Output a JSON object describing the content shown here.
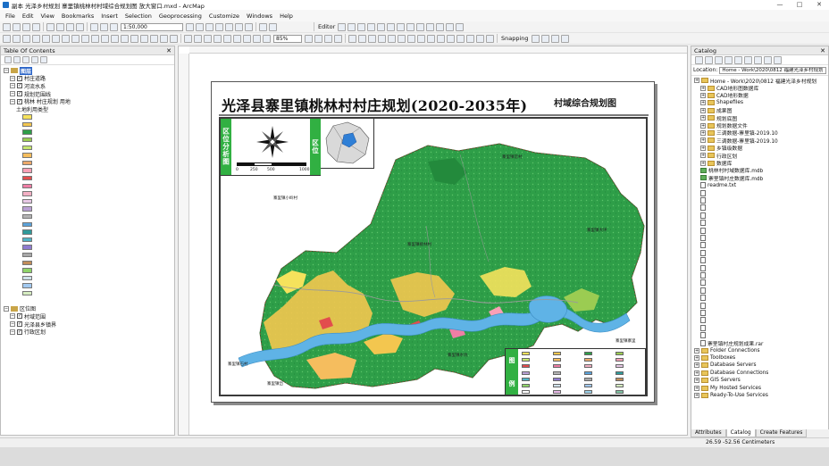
{
  "window": {
    "title": "副本 光泽乡村规划 寨里镇桃林村村域综合规划图 放大窗口.mxd - ArcMap"
  },
  "menu": [
    "File",
    "Edit",
    "View",
    "Bookmarks",
    "Insert",
    "Selection",
    "Geoprocessing",
    "Customize",
    "Windows",
    "Help"
  ],
  "toolbar": {
    "scale": "1:50,000",
    "zoom": "85%",
    "editor_label": "Editor",
    "snapping_label": "Snapping"
  },
  "toc": {
    "title": "Table Of Contents",
    "items": [
      {
        "label": "图层",
        "level": 0,
        "kind": "frame",
        "selected": true
      },
      {
        "label": "村庄道路",
        "level": 1,
        "kind": "layer"
      },
      {
        "label": "河流水系",
        "level": 1,
        "kind": "layer"
      },
      {
        "label": "规划范围线",
        "level": 1,
        "kind": "layer"
      },
      {
        "label": "桃林 村庄规划 用地",
        "level": 1,
        "kind": "layer"
      },
      {
        "label": "土地利用类型",
        "level": 2,
        "kind": "caption"
      },
      {
        "label": "",
        "level": 3,
        "kind": "legend",
        "color": "#f5e25c"
      },
      {
        "label": "",
        "level": 3,
        "kind": "legend",
        "color": "#f3c64f"
      },
      {
        "label": "",
        "level": 3,
        "kind": "legend",
        "color": "#2e9e48"
      },
      {
        "label": "",
        "level": 3,
        "kind": "legend",
        "color": "#9bcc52"
      },
      {
        "label": "",
        "level": 3,
        "kind": "legend",
        "color": "#c5e66e"
      },
      {
        "label": "",
        "level": 3,
        "kind": "legend",
        "color": "#f5bd5e"
      },
      {
        "label": "",
        "level": 3,
        "kind": "legend",
        "color": "#eca96a"
      },
      {
        "label": "",
        "level": 3,
        "kind": "legend",
        "color": "#f9a0b6"
      },
      {
        "label": "",
        "level": 3,
        "kind": "legend",
        "color": "#e24d4d"
      },
      {
        "label": "",
        "level": 3,
        "kind": "legend",
        "color": "#ef7ea5"
      },
      {
        "label": "",
        "level": 3,
        "kind": "legend",
        "color": "#f3b0c4"
      },
      {
        "label": "",
        "level": 3,
        "kind": "legend",
        "color": "#e7c8e5"
      },
      {
        "label": "",
        "level": 3,
        "kind": "legend",
        "color": "#b9a0d4"
      },
      {
        "label": "",
        "level": 3,
        "kind": "legend",
        "color": "#b3b3b3"
      },
      {
        "label": "",
        "level": 3,
        "kind": "legend",
        "color": "#5ba3db"
      },
      {
        "label": "",
        "level": 3,
        "kind": "legend",
        "color": "#2f9a9a"
      },
      {
        "label": "",
        "level": 3,
        "kind": "legend",
        "color": "#52b4c6"
      },
      {
        "label": "",
        "level": 3,
        "kind": "legend",
        "color": "#8f7bd0"
      },
      {
        "label": "",
        "level": 3,
        "kind": "legend",
        "color": "#a9a9a9"
      },
      {
        "label": "",
        "level": 3,
        "kind": "legend",
        "color": "#c18d5a"
      },
      {
        "label": "",
        "level": 3,
        "kind": "legend",
        "color": "#8fd46a"
      },
      {
        "label": "",
        "level": 3,
        "kind": "legend",
        "color": "#cfe1ea"
      },
      {
        "label": "",
        "level": 3,
        "kind": "legend",
        "color": "#a2c9f0"
      },
      {
        "label": "",
        "level": 3,
        "kind": "legend",
        "color": "#d5ecc0"
      },
      {
        "label": "",
        "level": 0,
        "kind": "spacer"
      },
      {
        "label": "区位图",
        "level": 0,
        "kind": "frame",
        "selected": false
      },
      {
        "label": "村域范围",
        "level": 1,
        "kind": "layer"
      },
      {
        "label": "光泽县乡镇界",
        "level": 1,
        "kind": "layer"
      },
      {
        "label": "行政区划",
        "level": 1,
        "kind": "layer"
      }
    ]
  },
  "map": {
    "title": "光泽县寨里镇桃林村村庄规划(2020-2035年)",
    "subtitle": "村域综合规划图",
    "inset_label_1": "区位分析图",
    "inset_label_2": "区位",
    "scalebar_ticks": [
      "0",
      "250",
      "500",
      "1000"
    ],
    "places": [
      {
        "text": "寨里镇小岭村"
      },
      {
        "text": "寨里镇桃林村"
      },
      {
        "text": "寨里镇官村"
      },
      {
        "text": "寨里镇大坪"
      },
      {
        "text": "寨里镇水坑"
      },
      {
        "text": "寨里镇石村"
      },
      {
        "text": "寨里镇岱"
      },
      {
        "text": "寨里镇寨里"
      }
    ],
    "legend_title": [
      "图",
      "例"
    ],
    "legend_entries": [
      {
        "color": "#f5e25c"
      },
      {
        "color": "#f3c64f"
      },
      {
        "color": "#2e9e48"
      },
      {
        "color": "#9bcc52"
      },
      {
        "color": "#c5e66e"
      },
      {
        "color": "#f5bd5e"
      },
      {
        "color": "#eca96a"
      },
      {
        "color": "#f9a0b6"
      },
      {
        "color": "#e24d4d"
      },
      {
        "color": "#ef7ea5"
      },
      {
        "color": "#f3b0c4"
      },
      {
        "color": "#e7c8e5"
      },
      {
        "color": "#b9a0d4"
      },
      {
        "color": "#b3b3b3"
      },
      {
        "color": "#5ba3db"
      },
      {
        "color": "#2f9a9a"
      },
      {
        "color": "#52b4c6"
      },
      {
        "color": "#8f7bd0"
      },
      {
        "color": "#a9a9a9"
      },
      {
        "color": "#c18d5a"
      },
      {
        "color": "#8fd46a"
      },
      {
        "color": "#cfe1ea"
      },
      {
        "color": "#a2c9f0"
      },
      {
        "color": "#d5ecc0"
      },
      {
        "color": "#ffffff"
      },
      {
        "color": "#e6b8e6"
      },
      {
        "color": "#9ad0e8"
      },
      {
        "color": "#7fc3a3"
      }
    ]
  },
  "catalog": {
    "title": "Catalog",
    "location_label": "Location:",
    "location_value": "Home - Work\\2020\\0812 福建光泽乡村规划",
    "items": [
      {
        "label": "Home - Work\\2020\\0812 福建光泽乡村规划",
        "level": 0,
        "kind": "folder"
      },
      {
        "label": "CAD地形图数据库",
        "level": 1,
        "kind": "folder"
      },
      {
        "label": "CAD地形数据",
        "level": 1,
        "kind": "folder"
      },
      {
        "label": "Shapefiles",
        "level": 1,
        "kind": "folder"
      },
      {
        "label": "成果图",
        "level": 1,
        "kind": "folder"
      },
      {
        "label": "规划底图",
        "level": 1,
        "kind": "folder"
      },
      {
        "label": "规划数据文件",
        "level": 1,
        "kind": "folder"
      },
      {
        "label": "三调数据-寨里镇-2019.10",
        "level": 1,
        "kind": "folder"
      },
      {
        "label": "三调数据-寨里镇-2019.10",
        "level": 1,
        "kind": "folder"
      },
      {
        "label": "乡镇级数据",
        "level": 1,
        "kind": "folder"
      },
      {
        "label": "行政区划",
        "level": 1,
        "kind": "folder"
      },
      {
        "label": "数据库",
        "level": 1,
        "kind": "folder"
      },
      {
        "label": "桃林村村域数据库.mdb",
        "level": 1,
        "kind": "gdb"
      },
      {
        "label": "寨里镇村庄数据库.mdb",
        "level": 1,
        "kind": "gdb"
      },
      {
        "label": "readme.txt",
        "level": 1,
        "kind": "doc"
      },
      {
        "label": "",
        "level": 1,
        "kind": "doc"
      },
      {
        "label": "",
        "level": 1,
        "kind": "doc"
      },
      {
        "label": "",
        "level": 1,
        "kind": "doc"
      },
      {
        "label": "",
        "level": 1,
        "kind": "doc"
      },
      {
        "label": "",
        "level": 1,
        "kind": "doc"
      },
      {
        "label": "",
        "level": 1,
        "kind": "doc"
      },
      {
        "label": "",
        "level": 1,
        "kind": "doc"
      },
      {
        "label": "",
        "level": 1,
        "kind": "doc"
      },
      {
        "label": "",
        "level": 1,
        "kind": "doc"
      },
      {
        "label": "",
        "level": 1,
        "kind": "doc"
      },
      {
        "label": "",
        "level": 1,
        "kind": "doc"
      },
      {
        "label": "",
        "level": 1,
        "kind": "doc"
      },
      {
        "label": "",
        "level": 1,
        "kind": "doc"
      },
      {
        "label": "",
        "level": 1,
        "kind": "doc"
      },
      {
        "label": "",
        "level": 1,
        "kind": "doc"
      },
      {
        "label": "",
        "level": 1,
        "kind": "doc"
      },
      {
        "label": "",
        "level": 1,
        "kind": "doc"
      },
      {
        "label": "",
        "level": 1,
        "kind": "doc"
      },
      {
        "label": "",
        "level": 1,
        "kind": "doc"
      },
      {
        "label": "",
        "level": 1,
        "kind": "doc"
      },
      {
        "label": "寨里镇村庄规划成果.rar",
        "level": 1,
        "kind": "doc"
      },
      {
        "label": "Folder Connections",
        "level": 0,
        "kind": "folder"
      },
      {
        "label": "Toolboxes",
        "level": 0,
        "kind": "folder"
      },
      {
        "label": "Database Servers",
        "level": 0,
        "kind": "folder"
      },
      {
        "label": "Database Connections",
        "level": 0,
        "kind": "folder"
      },
      {
        "label": "GIS Servers",
        "level": 0,
        "kind": "folder"
      },
      {
        "label": "My Hosted Services",
        "level": 0,
        "kind": "folder"
      },
      {
        "label": "Ready-To-Use Services",
        "level": 0,
        "kind": "folder"
      }
    ]
  },
  "tabs": [
    "Attributes",
    "Catalog",
    "Create Features"
  ],
  "status": {
    "coordinates": "26.59  -52.56 Centimeters"
  }
}
